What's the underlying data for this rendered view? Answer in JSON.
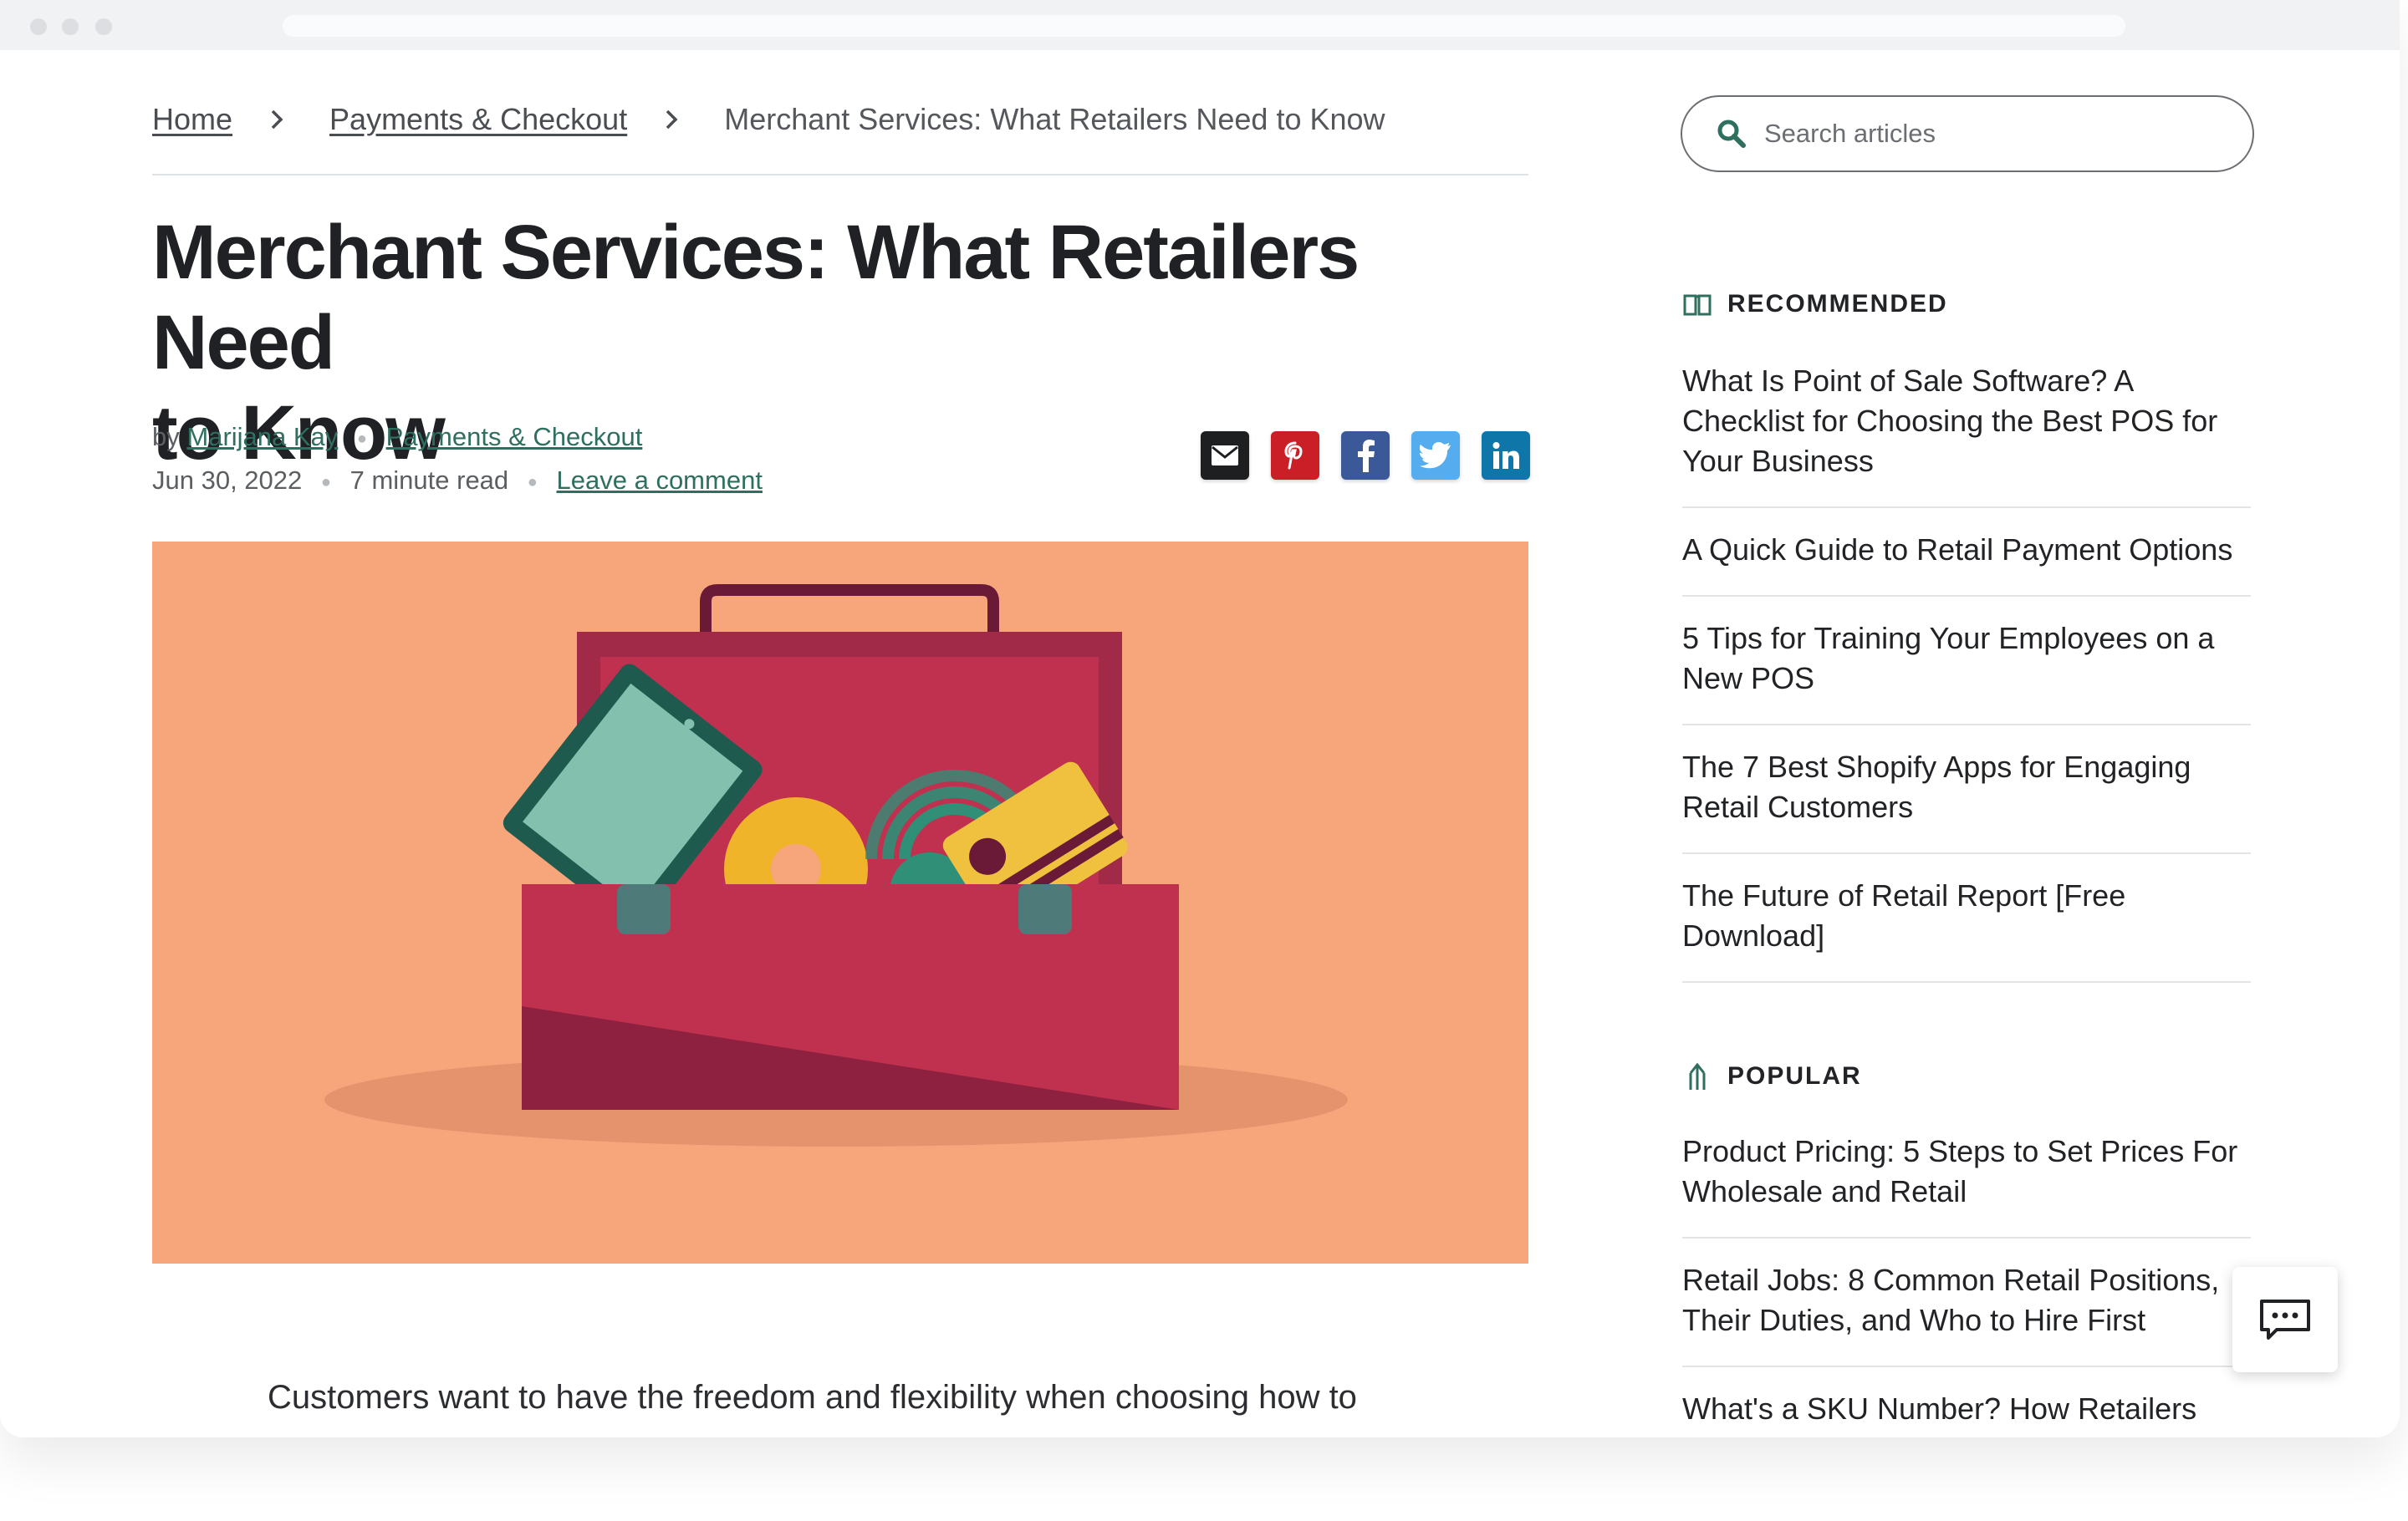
{
  "breadcrumb": {
    "home": "Home",
    "category": "Payments & Checkout",
    "current": "Merchant Services: What Retailers Need to Know"
  },
  "article": {
    "title_line1": "Merchant Services: What Retailers Need",
    "title_line2": "to Know",
    "by": "by",
    "author": "Marijana Kay",
    "category": "Payments & Checkout",
    "date": "Jun 30, 2022",
    "read_time": "7 minute read",
    "comment_link": "Leave a comment",
    "lead_text": "Customers want to have the freedom and flexibility when choosing how to"
  },
  "share": [
    "email-icon",
    "pinterest-icon",
    "facebook-icon",
    "twitter-icon",
    "linkedin-icon"
  ],
  "search": {
    "placeholder": "Search articles"
  },
  "sidebar": {
    "recommended_heading": "RECOMMENDED",
    "recommended": [
      "What Is Point of Sale Software? A Checklist for Choosing the Best POS for Your Business",
      "A Quick Guide to Retail Payment Options",
      "5 Tips for Training Your Employees on a New POS",
      "The 7 Best Shopify Apps for Engaging Retail Customers",
      "The Future of Retail Report [Free Download]"
    ],
    "popular_heading": "POPULAR",
    "popular": [
      "Product Pricing: 5 Steps to Set Prices For Wholesale and Retail",
      "Retail Jobs: 8 Common Retail Positions, Their Duties, and Who to Hire First",
      "What's a SKU Number? How Retailers Can"
    ]
  },
  "colors": {
    "accent_green": "#2f6f5f",
    "hero_bg": "#f7a67c",
    "toolbox": "#c0304f",
    "pinterest": "#cb1f27",
    "facebook": "#3b5998",
    "twitter": "#55acee",
    "linkedin": "#0e76a8"
  }
}
